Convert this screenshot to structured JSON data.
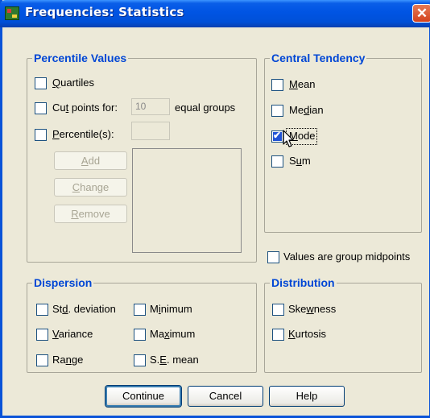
{
  "window": {
    "title": "Frequencies: Statistics",
    "close_glyph": "✕"
  },
  "percentile": {
    "title": "Percentile Values",
    "quartiles": {
      "label_pre": "",
      "label_ul": "Q",
      "label_post": "uartiles",
      "checked": false
    },
    "cut_points": {
      "label_pre": "Cu",
      "label_ul": "t",
      "label_post": " points for:",
      "value": "10",
      "suffix": "equal groups",
      "checked": false
    },
    "percentiles": {
      "label_pre": "",
      "label_ul": "P",
      "label_post": "ercentile(s):",
      "value": "",
      "checked": false
    },
    "add": {
      "pre": "",
      "ul": "A",
      "post": "dd"
    },
    "change": {
      "pre": "",
      "ul": "C",
      "post": "hange"
    },
    "remove": {
      "pre": "",
      "ul": "R",
      "post": "emove"
    }
  },
  "central": {
    "title": "Central Tendency",
    "mean": {
      "pre": "",
      "ul": "M",
      "post": "ean",
      "checked": false
    },
    "median": {
      "pre": "Me",
      "ul": "d",
      "post": "ian",
      "checked": false
    },
    "mode": {
      "pre": "",
      "ul": "M",
      "post": "ode",
      "checked": true
    },
    "sum": {
      "pre": "S",
      "ul": "u",
      "post": "m",
      "checked": false
    }
  },
  "midpoints": {
    "label": "Values are group midpoints",
    "checked": false
  },
  "dispersion": {
    "title": "Dispersion",
    "std": {
      "pre": "St",
      "ul": "d",
      "post": ". deviation",
      "checked": false
    },
    "minimum": {
      "pre": "M",
      "ul": "i",
      "post": "nimum",
      "checked": false
    },
    "variance": {
      "pre": "",
      "ul": "V",
      "post": "ariance",
      "checked": false
    },
    "maximum": {
      "pre": "Ma",
      "ul": "x",
      "post": "imum",
      "checked": false
    },
    "range": {
      "pre": "Ra",
      "ul": "n",
      "post": "ge",
      "checked": false
    },
    "se_mean": {
      "pre": "S.",
      "ul": "E",
      "post": ". mean",
      "checked": false
    }
  },
  "distribution": {
    "title": "Distribution",
    "skewness": {
      "pre": "Ske",
      "ul": "w",
      "post": "ness",
      "checked": false
    },
    "kurtosis": {
      "pre": "",
      "ul": "K",
      "post": "urtosis",
      "checked": false
    }
  },
  "buttons": {
    "continue": "Continue",
    "cancel": "Cancel",
    "help": "Help"
  }
}
